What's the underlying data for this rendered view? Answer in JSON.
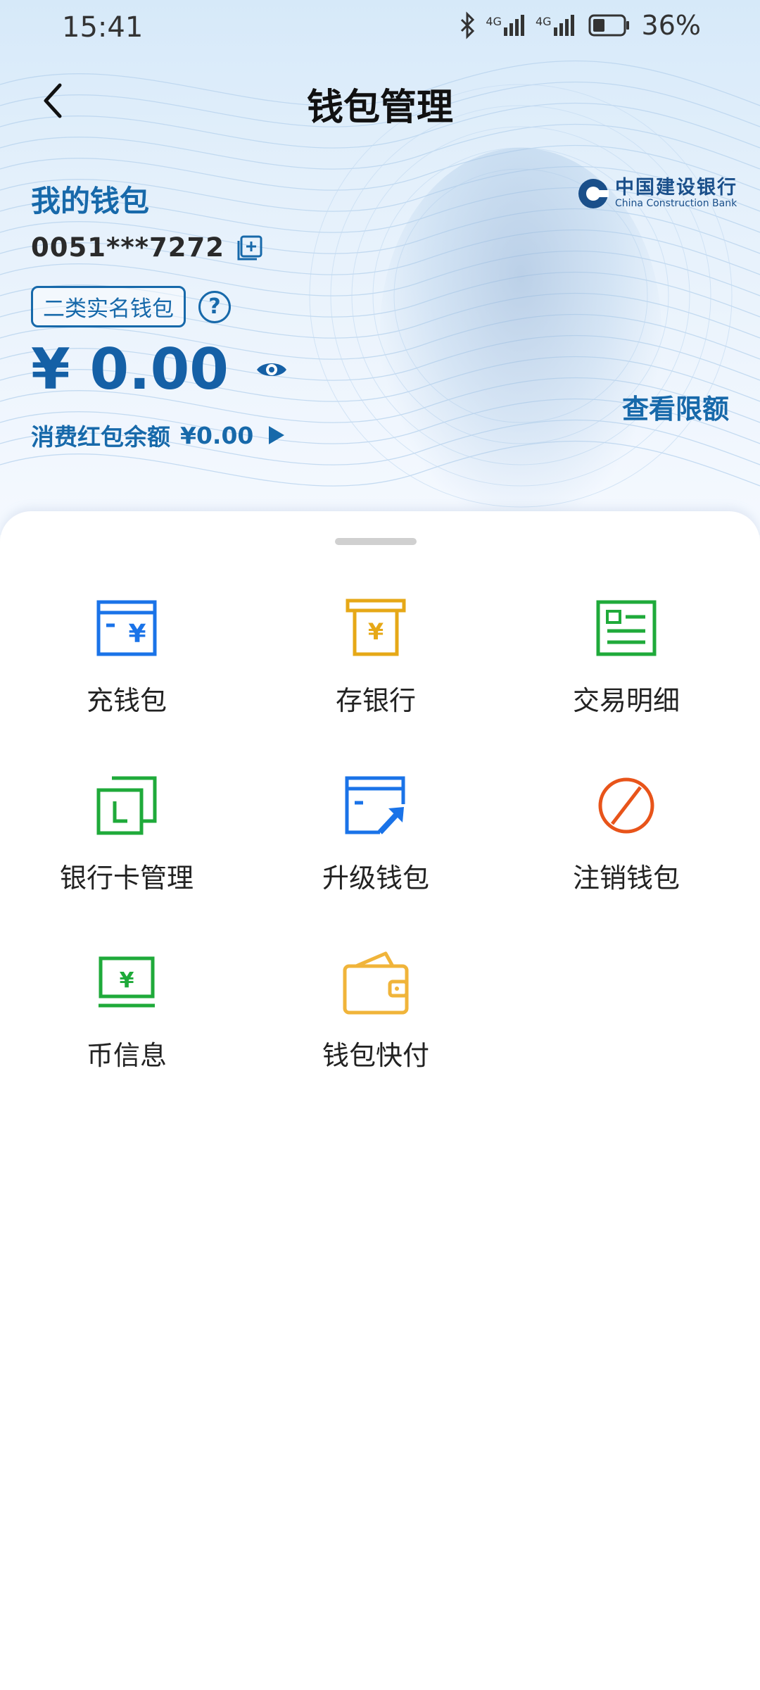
{
  "status_bar": {
    "time": "15:41",
    "network_1": "4G",
    "network_2": "4G",
    "battery": "36%"
  },
  "header": {
    "title": "钱包管理",
    "back_icon": "chevron-left-icon"
  },
  "wallet": {
    "title": "我的钱包",
    "number": "0051***7272",
    "tag": "二类实名钱包",
    "help": "?",
    "balance": "¥ 0.00",
    "limit_link": "查看限额",
    "coupon_label": "消费红包余额",
    "coupon_value": "¥0.00",
    "bank_name_cn": "中国建设银行",
    "bank_name_en": "China Construction Bank"
  },
  "menu": [
    {
      "label": "充钱包",
      "icon": "wallet-topup-icon",
      "color": "#1a73e8"
    },
    {
      "label": "存银行",
      "icon": "bank-deposit-icon",
      "color": "#e6a817"
    },
    {
      "label": "交易明细",
      "icon": "transaction-list-icon",
      "color": "#1faa3a"
    },
    {
      "label": "银行卡管理",
      "icon": "bank-card-manage-icon",
      "color": "#1faa3a"
    },
    {
      "label": "升级钱包",
      "icon": "upgrade-wallet-icon",
      "color": "#1a73e8"
    },
    {
      "label": "注销钱包",
      "icon": "cancel-wallet-icon",
      "color": "#e8541a"
    },
    {
      "label": "币信息",
      "icon": "currency-info-icon",
      "color": "#1faa3a"
    },
    {
      "label": "钱包快付",
      "icon": "wallet-quickpay-icon",
      "color": "#f0b43a"
    }
  ],
  "colors": {
    "accent_blue": "#1769aa",
    "title_black": "#111111"
  }
}
